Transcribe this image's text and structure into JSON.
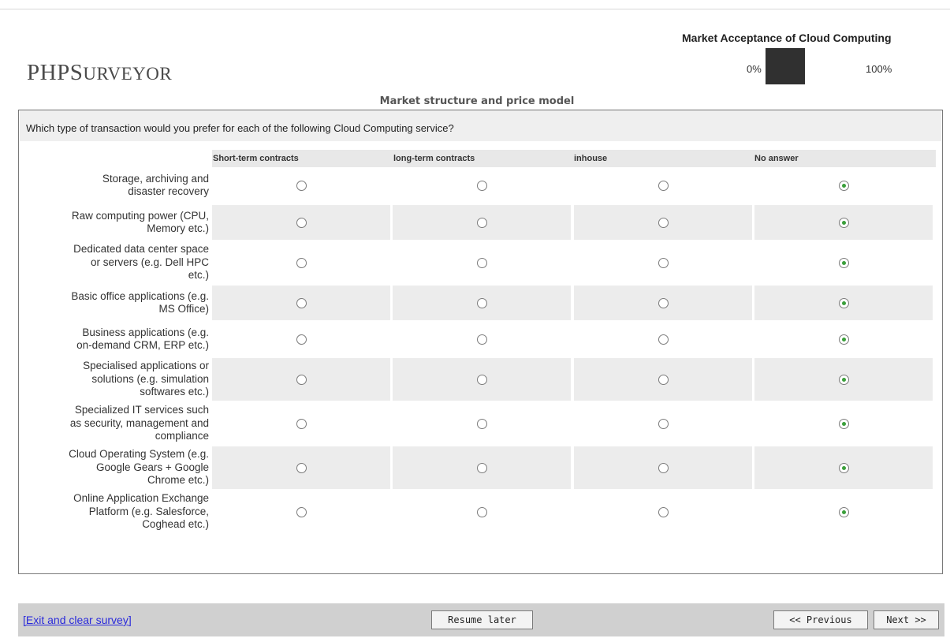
{
  "header": {
    "logo_prefix": "PHP",
    "logo_s": "S",
    "logo_rest": "URVEYOR",
    "survey_title": "Market Acceptance of Cloud Computing",
    "progress": {
      "label_start": "0%",
      "label_end": "100%",
      "value_percent": 0
    }
  },
  "group_name": "Market structure and price model",
  "question": {
    "text": "Which type of transaction would you prefer for each of the following Cloud Computing service?",
    "columns": [
      "Short-term contracts",
      "long-term contracts",
      "inhouse",
      "No answer"
    ],
    "rows": [
      {
        "label": [
          "Storage, archiving and",
          "disaster recovery"
        ],
        "selected": 3
      },
      {
        "label": [
          "Raw computing power (CPU,",
          "Memory etc.)"
        ],
        "selected": 3
      },
      {
        "label": [
          "Dedicated data center space",
          "or servers (e.g. Dell HPC",
          "etc.)"
        ],
        "selected": 3
      },
      {
        "label": [
          "Basic office applications (e.g.",
          "MS Office)"
        ],
        "selected": 3
      },
      {
        "label": [
          "Business applications (e.g.",
          "on-demand CRM, ERP etc.)"
        ],
        "selected": 3
      },
      {
        "label": [
          "Specialised applications or",
          "solutions (e.g. simulation",
          "softwares etc.)"
        ],
        "selected": 3
      },
      {
        "label": [
          "Specialized IT services such",
          "as security, management and",
          "compliance"
        ],
        "selected": 3
      },
      {
        "label": [
          "Cloud Operating System (e.g.",
          "Google Gears + Google",
          "Chrome etc.)"
        ],
        "selected": 3
      },
      {
        "label": [
          "Online Application Exchange",
          "Platform (e.g. Salesforce,",
          "Coghead etc.)"
        ],
        "selected": 3
      }
    ]
  },
  "footer": {
    "exit_label": "[Exit and clear survey]",
    "resume_label": "Resume later",
    "previous_label": "<< Previous",
    "next_label": "Next >>"
  },
  "colors": {
    "selected_dot": "#3a9f3a",
    "link": "#2a2adb",
    "footer_bg": "#d0d0d0"
  }
}
